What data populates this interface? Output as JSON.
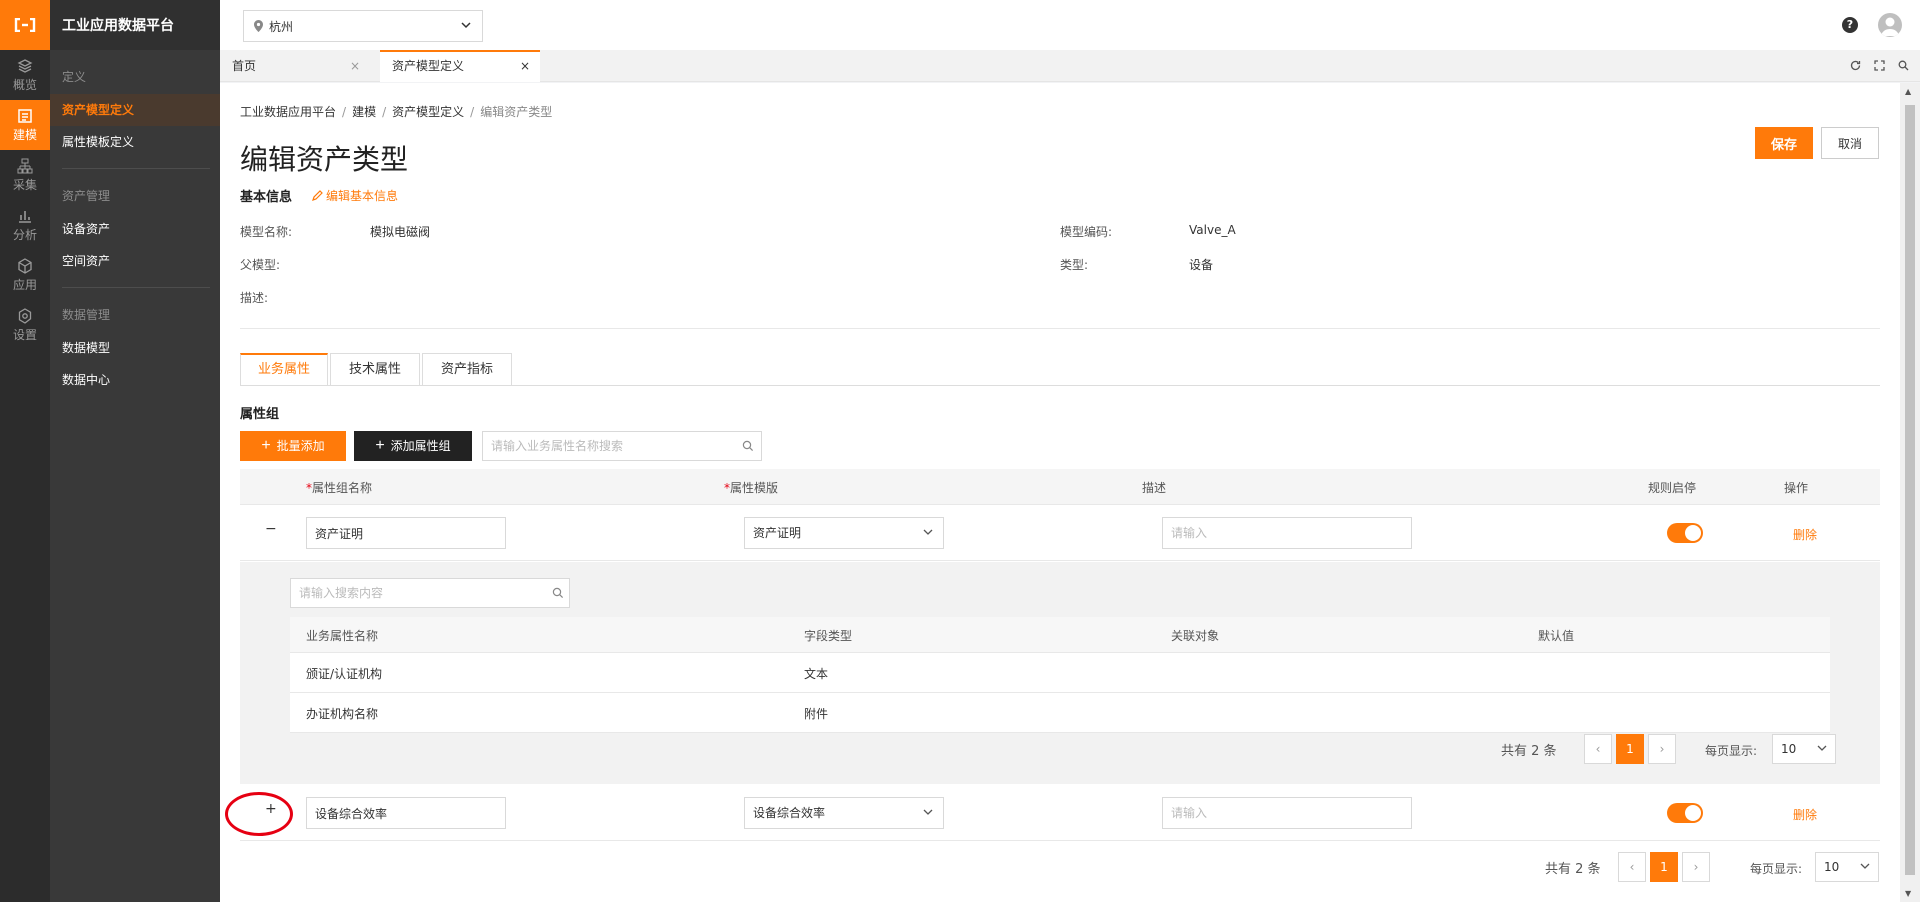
{
  "nav": {
    "rail": [
      {
        "label": "概览",
        "icon": "layers-icon"
      },
      {
        "label": "建模",
        "icon": "model-icon",
        "active": true
      },
      {
        "label": "采集",
        "icon": "sitemap-icon"
      },
      {
        "label": "分析",
        "icon": "bar-chart-icon"
      },
      {
        "label": "应用",
        "icon": "cube-icon"
      },
      {
        "label": "设置",
        "icon": "gear-icon"
      }
    ]
  },
  "sidebar": {
    "brand": "工业应用数据平台",
    "groups": [
      {
        "title": "定义",
        "items": [
          "资产模型定义",
          "属性模板定义"
        ]
      },
      {
        "title": "资产管理",
        "items": [
          "设备资产",
          "空间资产"
        ]
      },
      {
        "title": "数据管理",
        "items": [
          "数据模型",
          "数据中心"
        ]
      }
    ]
  },
  "topbar": {
    "city": "杭州"
  },
  "tabs": [
    {
      "label": "首页"
    },
    {
      "label": "资产模型定义",
      "active": true
    }
  ],
  "breadcrumb": [
    "工业数据应用平台",
    "建模",
    "资产模型定义",
    "编辑资产类型"
  ],
  "page": {
    "title": "编辑资产类型",
    "save": "保存",
    "cancel": "取消"
  },
  "basic": {
    "title": "基本信息",
    "edit": "编辑基本信息",
    "fields": {
      "model_name_label": "模型名称:",
      "model_name": "模拟电磁阀",
      "model_code_label": "模型编码:",
      "model_code": "Valve_A",
      "parent_label": "父模型:",
      "type_label": "类型:",
      "type": "设备",
      "desc_label": "描述:"
    }
  },
  "attr_tabs": [
    "业务属性",
    "技术属性",
    "资产指标"
  ],
  "attr_group": {
    "title": "属性组",
    "batch_add": "批量添加",
    "add_group": "添加属性组",
    "search_placeholder": "请输入业务属性名称搜索",
    "columns": [
      "属性组名称",
      "属性模版",
      "描述",
      "规则启停",
      "操作"
    ],
    "rows": [
      {
        "name": "资产证明",
        "template": "资产证明",
        "desc_placeholder": "请输入",
        "enabled": true,
        "action": "删除",
        "expander": "−"
      },
      {
        "name": "设备综合效率",
        "template": "设备综合效率",
        "desc_placeholder": "请输入",
        "enabled": true,
        "action": "删除",
        "expander": "+"
      }
    ]
  },
  "sub_table": {
    "search_placeholder": "请输入搜索内容",
    "columns": [
      "业务属性名称",
      "字段类型",
      "关联对象",
      "默认值"
    ],
    "rows": [
      [
        "颁证/认证机构",
        "文本",
        "",
        ""
      ],
      [
        "办证机构名称",
        "附件",
        "",
        ""
      ]
    ],
    "pager": {
      "total": "共有 2 条",
      "page": "1",
      "size_label": "每页显示:",
      "size": "10"
    }
  },
  "pager": {
    "total": "共有 2 条",
    "page": "1",
    "size_label": "每页显示:",
    "size": "10"
  },
  "colors": {
    "accent": "#ff7a0a",
    "dark": "#222222",
    "danger": "#e60012"
  }
}
